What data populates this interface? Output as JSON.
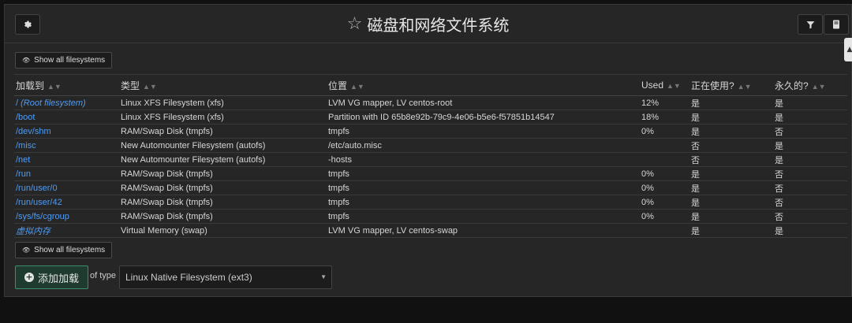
{
  "header": {
    "title": "磁盘和网络文件系统",
    "icons": [
      "gear-icon",
      "star-icon",
      "filter-icon",
      "book-icon"
    ]
  },
  "show_all_label": "Show all filesystems",
  "table": {
    "columns": [
      "加载到",
      "类型",
      "位置",
      "Used",
      "正在使用?",
      "永久的?"
    ],
    "rows": [
      {
        "mount": "/ ",
        "mount_italic": "(Root filesystem)",
        "type": "Linux XFS Filesystem (xfs)",
        "location": "LVM VG mapper, LV centos-root",
        "used": "12%",
        "in_use": "是",
        "in_use_state": "yes",
        "permanent": "是",
        "permanent_state": "plain"
      },
      {
        "mount": "/boot",
        "mount_italic": "",
        "type": "Linux XFS Filesystem (xfs)",
        "location": "Partition with ID 65b8e92b-79c9-4e06-b5e6-f57851b14547",
        "used": "18%",
        "in_use": "是",
        "in_use_state": "yes",
        "permanent": "是",
        "permanent_state": "plain"
      },
      {
        "mount": "/dev/shm",
        "mount_italic": "",
        "type": "RAM/Swap Disk (tmpfs)",
        "location": "tmpfs",
        "used": "0%",
        "in_use": "是",
        "in_use_state": "yes",
        "permanent": "否",
        "permanent_state": "no"
      },
      {
        "mount": "/misc",
        "mount_italic": "",
        "type": "New Automounter Filesystem (autofs)",
        "location": "/etc/auto.misc",
        "used": "",
        "in_use": "否",
        "in_use_state": "no",
        "permanent": "是",
        "permanent_state": "plain"
      },
      {
        "mount": "/net",
        "mount_italic": "",
        "type": "New Automounter Filesystem (autofs)",
        "location": "-hosts",
        "used": "",
        "in_use": "否",
        "in_use_state": "no",
        "permanent": "是",
        "permanent_state": "plain"
      },
      {
        "mount": "/run",
        "mount_italic": "",
        "type": "RAM/Swap Disk (tmpfs)",
        "location": "tmpfs",
        "used": "0%",
        "in_use": "是",
        "in_use_state": "yes",
        "permanent": "否",
        "permanent_state": "no"
      },
      {
        "mount": "/run/user/0",
        "mount_italic": "",
        "type": "RAM/Swap Disk (tmpfs)",
        "location": "tmpfs",
        "used": "0%",
        "in_use": "是",
        "in_use_state": "yes",
        "permanent": "否",
        "permanent_state": "no"
      },
      {
        "mount": "/run/user/42",
        "mount_italic": "",
        "type": "RAM/Swap Disk (tmpfs)",
        "location": "tmpfs",
        "used": "0%",
        "in_use": "是",
        "in_use_state": "yes",
        "permanent": "否",
        "permanent_state": "no"
      },
      {
        "mount": "/sys/fs/cgroup",
        "mount_italic": "",
        "type": "RAM/Swap Disk (tmpfs)",
        "location": "tmpfs",
        "used": "0%",
        "in_use": "是",
        "in_use_state": "yes",
        "permanent": "否",
        "permanent_state": "no"
      },
      {
        "mount": "",
        "mount_italic": "虚拟内存",
        "type": "Virtual Memory (swap)",
        "location": "LVM VG mapper, LV centos-swap",
        "used": "",
        "in_use": "是",
        "in_use_state": "yes",
        "permanent": "是",
        "permanent_state": "plain"
      }
    ]
  },
  "add_mount": {
    "button_label": "添加加载",
    "of_type_label": "of type",
    "selected_type": "Linux Native Filesystem (ext3)"
  },
  "colors": {
    "link_blue": "#4f9cf5",
    "no_red": "#e05a4f",
    "add_green": "#3e8e6a"
  }
}
